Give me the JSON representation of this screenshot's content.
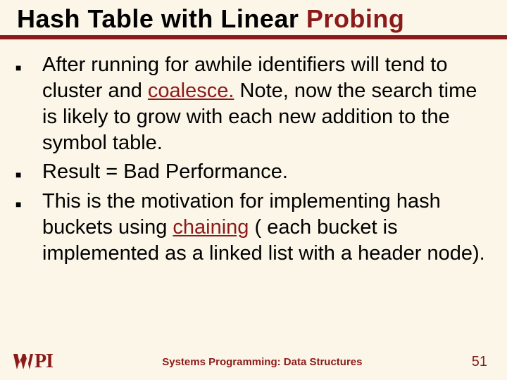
{
  "title": {
    "pre": "Hash Table with Linear ",
    "accent": "Probing"
  },
  "bullets": [
    {
      "pre": "After running for awhile identifiers will tend to cluster and ",
      "accent": "coalesce.",
      "post": " Note, now the search time is likely to grow with each new addition to the symbol table."
    },
    {
      "pre": "Result = Bad Performance.",
      "accent": "",
      "post": ""
    },
    {
      "pre": "This is the motivation for implementing hash buckets using ",
      "accent": "chaining",
      "post": " ( each bucket is implemented as a linked list with a header node)."
    }
  ],
  "footer": {
    "logo_text": "PI",
    "text": "Systems Programming:   Data Structures",
    "page": "51"
  }
}
